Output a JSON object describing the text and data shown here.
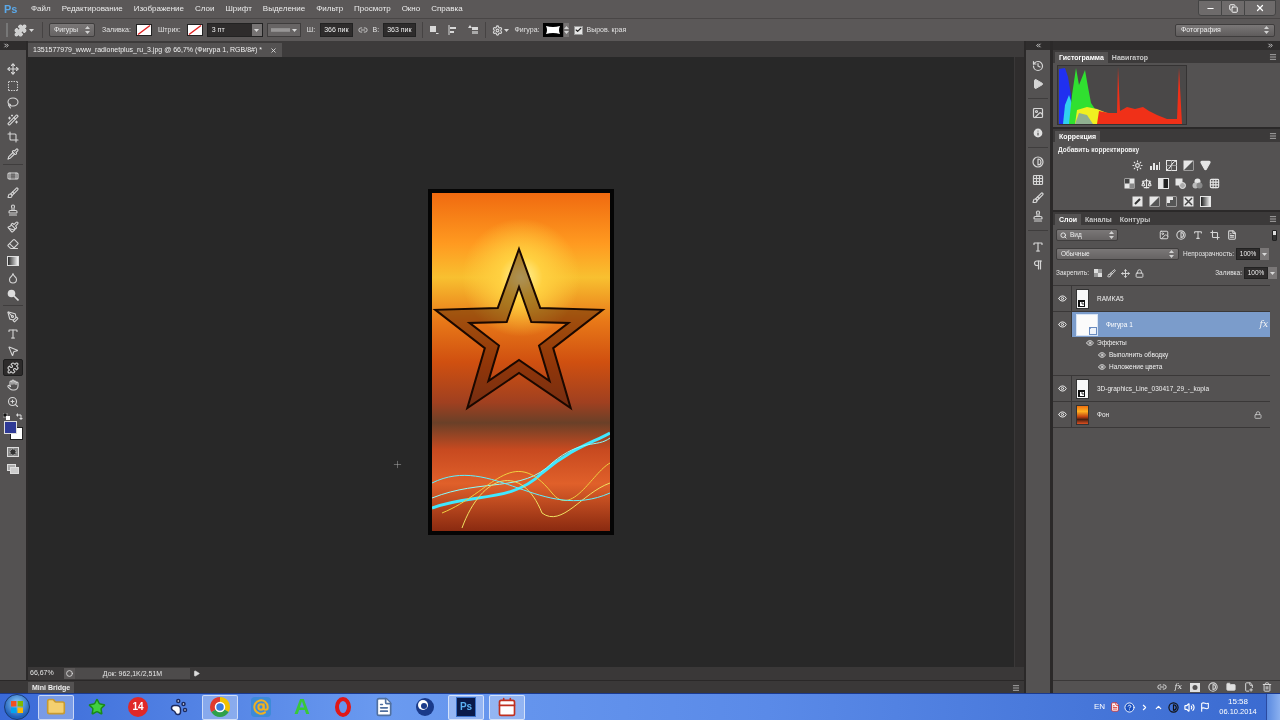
{
  "app": {
    "logo": "Ps"
  },
  "menu": [
    "Файл",
    "Редактирование",
    "Изображение",
    "Слои",
    "Шрифт",
    "Выделение",
    "Фильтр",
    "Просмотр",
    "Окно",
    "Справка"
  ],
  "options_bar": {
    "mode": "Фигуры",
    "fill_label": "Заливка:",
    "stroke_label": "Штрих:",
    "stroke_width": "3 пт",
    "width_label": "Ш:",
    "width": "366 пик",
    "height_label": "В:",
    "height": "363 пик",
    "shape_label": "Фигура:",
    "align_edges": {
      "label": "Выров. края",
      "checked": true
    }
  },
  "workspace": "Фотография",
  "document_tab": {
    "title": "1351577979_www_radionetplus_ru_3.jpg @ 66,7% (Фигура 1, RGB/8#) *"
  },
  "tool_groups": [
    [
      {
        "kind": "move",
        "selected": false
      },
      {
        "kind": "marquee",
        "selected": false
      },
      {
        "kind": "lasso",
        "selected": false
      },
      {
        "kind": "quick_select",
        "selected": false
      },
      {
        "kind": "crop",
        "selected": false
      },
      {
        "kind": "eyedropper",
        "selected": false
      }
    ],
    [
      {
        "kind": "healing",
        "selected": false
      },
      {
        "kind": "brush",
        "selected": false
      },
      {
        "kind": "stamp",
        "selected": false
      },
      {
        "kind": "history_brush",
        "selected": false
      },
      {
        "kind": "eraser",
        "selected": false
      },
      {
        "kind": "gradient",
        "selected": false
      },
      {
        "kind": "blur",
        "selected": false
      },
      {
        "kind": "dodge",
        "selected": false
      }
    ],
    [
      {
        "kind": "pen",
        "selected": false
      },
      {
        "kind": "type",
        "selected": false
      },
      {
        "kind": "path_select",
        "selected": false
      },
      {
        "kind": "shape",
        "selected": true
      },
      {
        "kind": "hand",
        "selected": false
      },
      {
        "kind": "zoom",
        "selected": false
      }
    ]
  ],
  "status_bar": {
    "zoom": "66,67%",
    "doc_info": "Док: 962,1K/2,51M"
  },
  "mini_bridge": {
    "tab": "Mini Bridge"
  },
  "histogram_panel": {
    "tabs": [
      {
        "label": "Гистограмма",
        "selected": true
      },
      {
        "label": "Навигатор",
        "selected": false
      }
    ]
  },
  "adjustments_panel": {
    "tabs": [
      {
        "label": "Коррекция",
        "selected": true
      }
    ],
    "heading": "Добавить корректировку"
  },
  "layers_panel": {
    "tabs": [
      {
        "label": "Слои",
        "selected": true
      },
      {
        "label": "Каналы",
        "selected": false
      },
      {
        "label": "Контуры",
        "selected": false
      }
    ],
    "filter": "Вид",
    "blend_mode": "Обычные",
    "opacity_label": "Непрозрачность:",
    "opacity": "100%",
    "lock_label": "Закрепить:",
    "fill_label": "Заливка:",
    "fill": "100%",
    "layers": [
      {
        "name": "RAMKA5",
        "kind": "smart",
        "visible": true,
        "selected": false,
        "locked": false
      },
      {
        "name": "Фигура 1",
        "kind": "shape",
        "visible": true,
        "selected": true,
        "locked": false,
        "effects_badge": "fx",
        "children": [
          {
            "name": "Эффекты",
            "visible": true,
            "children": [
              {
                "name": "Выполнить обводку",
                "visible": true
              },
              {
                "name": "Наложение цвета",
                "visible": true
              }
            ]
          }
        ]
      },
      {
        "name": "3D-graphics_Line_030417_29_-_kopia",
        "kind": "smart",
        "visible": true,
        "selected": false,
        "locked": false
      },
      {
        "name": "Фон",
        "kind": "photo",
        "visible": true,
        "selected": false,
        "locked": true
      }
    ],
    "bottom_buttons": [
      {
        "kind": "link"
      },
      {
        "kind": "fx",
        "label": "fx"
      },
      {
        "kind": "mask"
      },
      {
        "kind": "adjust"
      },
      {
        "kind": "folder"
      },
      {
        "kind": "new"
      },
      {
        "kind": "trash"
      }
    ]
  },
  "taskbar": {
    "apps": [
      {
        "kind": "folder",
        "active": true
      },
      {
        "kind": "star",
        "active": false
      },
      {
        "kind": "badge",
        "label": "14",
        "active": false
      },
      {
        "kind": "paw",
        "active": false
      },
      {
        "kind": "chrome",
        "active": true
      },
      {
        "kind": "mail",
        "active": false
      },
      {
        "kind": "letter",
        "label": "A",
        "active": false
      },
      {
        "kind": "opera",
        "active": false
      },
      {
        "kind": "document",
        "active": false
      },
      {
        "kind": "sphere",
        "active": false
      },
      {
        "kind": "ps",
        "label": "Ps",
        "active": true
      },
      {
        "kind": "calendar",
        "active": true
      }
    ],
    "tray": {
      "language": "EN",
      "time": "15:58",
      "date": "06.10.2014"
    }
  }
}
